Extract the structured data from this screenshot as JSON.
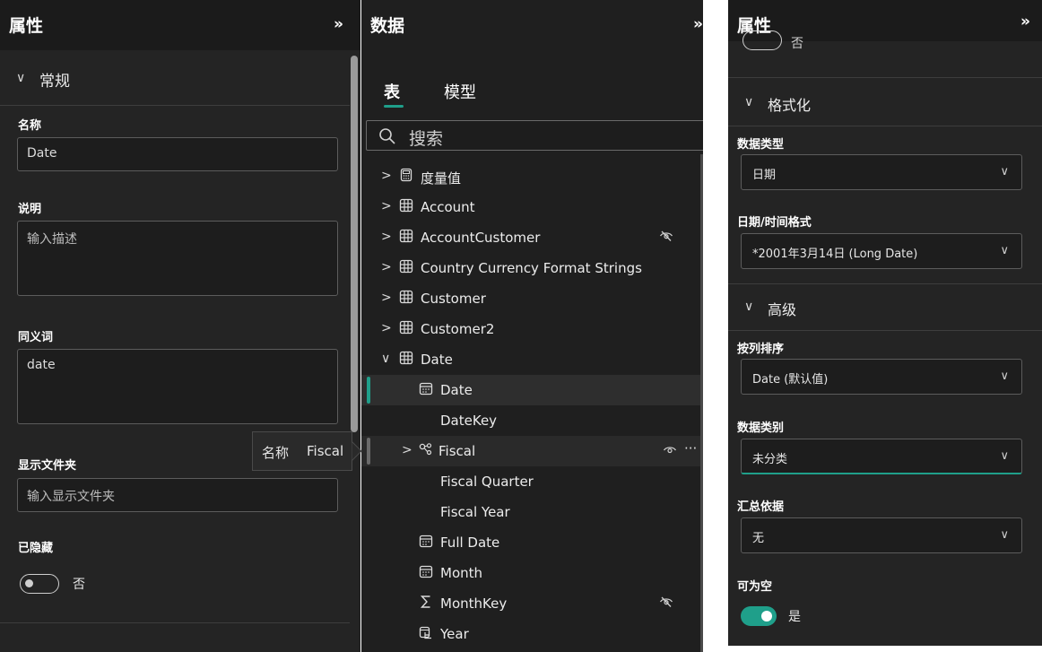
{
  "colors": {
    "accent": "#1f9f8a",
    "panel_bg": "#242424",
    "header_bg": "#1b1b1b"
  },
  "left": {
    "title": "属性",
    "collapse": "»",
    "section_general": {
      "chevron": "∨",
      "label": "常规"
    },
    "name": {
      "label": "名称",
      "value": "Date"
    },
    "description": {
      "label": "说明",
      "placeholder": "输入描述"
    },
    "synonyms": {
      "label": "同义词",
      "value": "date"
    },
    "display_folder": {
      "label": "显示文件夹",
      "placeholder": "输入显示文件夹"
    },
    "hidden": {
      "label": "已隐藏",
      "value": "否",
      "on": false
    }
  },
  "tooltip": {
    "key": "名称",
    "value": "Fiscal"
  },
  "middle": {
    "title": "数据",
    "collapse": "»",
    "tabs": [
      {
        "label": "表",
        "active": true
      },
      {
        "label": "模型",
        "active": false
      }
    ],
    "search_placeholder": "搜索",
    "tree": [
      {
        "label": "度量值",
        "icon": "calculator-icon",
        "expander": "›",
        "hidden": false
      },
      {
        "label": "Account",
        "icon": "table-icon",
        "expander": "›",
        "hidden": false
      },
      {
        "label": "AccountCustomer",
        "icon": "table-icon",
        "expander": "›",
        "hidden": true
      },
      {
        "label": "Country Currency Format Strings",
        "icon": "table-icon",
        "expander": "›",
        "hidden": false
      },
      {
        "label": "Customer",
        "icon": "table-icon",
        "expander": "›",
        "hidden": false
      },
      {
        "label": "Customer2",
        "icon": "table-icon",
        "expander": "›",
        "hidden": false
      },
      {
        "label": "Date",
        "icon": "table-icon",
        "expander": "∨",
        "hidden": false
      },
      {
        "label": "Date",
        "icon": "calendar-icon",
        "expander": "",
        "hidden": false,
        "selected": true
      },
      {
        "label": "DateKey",
        "icon": "",
        "expander": "",
        "hidden": false
      },
      {
        "label": "Fiscal",
        "icon": "hierarchy-icon",
        "expander": "›",
        "hidden": false,
        "hover": true
      },
      {
        "label": "Fiscal Quarter",
        "icon": "",
        "expander": "",
        "hidden": false
      },
      {
        "label": "Fiscal Year",
        "icon": "",
        "expander": "",
        "hidden": false
      },
      {
        "label": "Full Date",
        "icon": "calendar-icon",
        "expander": "",
        "hidden": false
      },
      {
        "label": "Month",
        "icon": "calendar-icon",
        "expander": "",
        "hidden": false
      },
      {
        "label": "MonthKey",
        "icon": "sigma-icon",
        "expander": "",
        "hidden": true
      },
      {
        "label": "Year",
        "icon": "calendar-hierarchy-icon",
        "expander": "",
        "hidden": false
      }
    ]
  },
  "right": {
    "title": "属性",
    "collapse": "»",
    "hidden_value": "否",
    "section_format": {
      "chevron": "∨",
      "label": "格式化"
    },
    "data_type": {
      "label": "数据类型",
      "value": "日期"
    },
    "date_format": {
      "label": "日期/时间格式",
      "value": "*2001年3月14日 (Long Date)"
    },
    "section_advanced": {
      "chevron": "∨",
      "label": "高级"
    },
    "sort_by": {
      "label": "按列排序",
      "value": "Date (默认值)"
    },
    "data_category": {
      "label": "数据类别",
      "value": "未分类"
    },
    "summarize_by": {
      "label": "汇总依据",
      "value": "无"
    },
    "nullable": {
      "label": "可为空",
      "value": "是",
      "on": true
    }
  }
}
